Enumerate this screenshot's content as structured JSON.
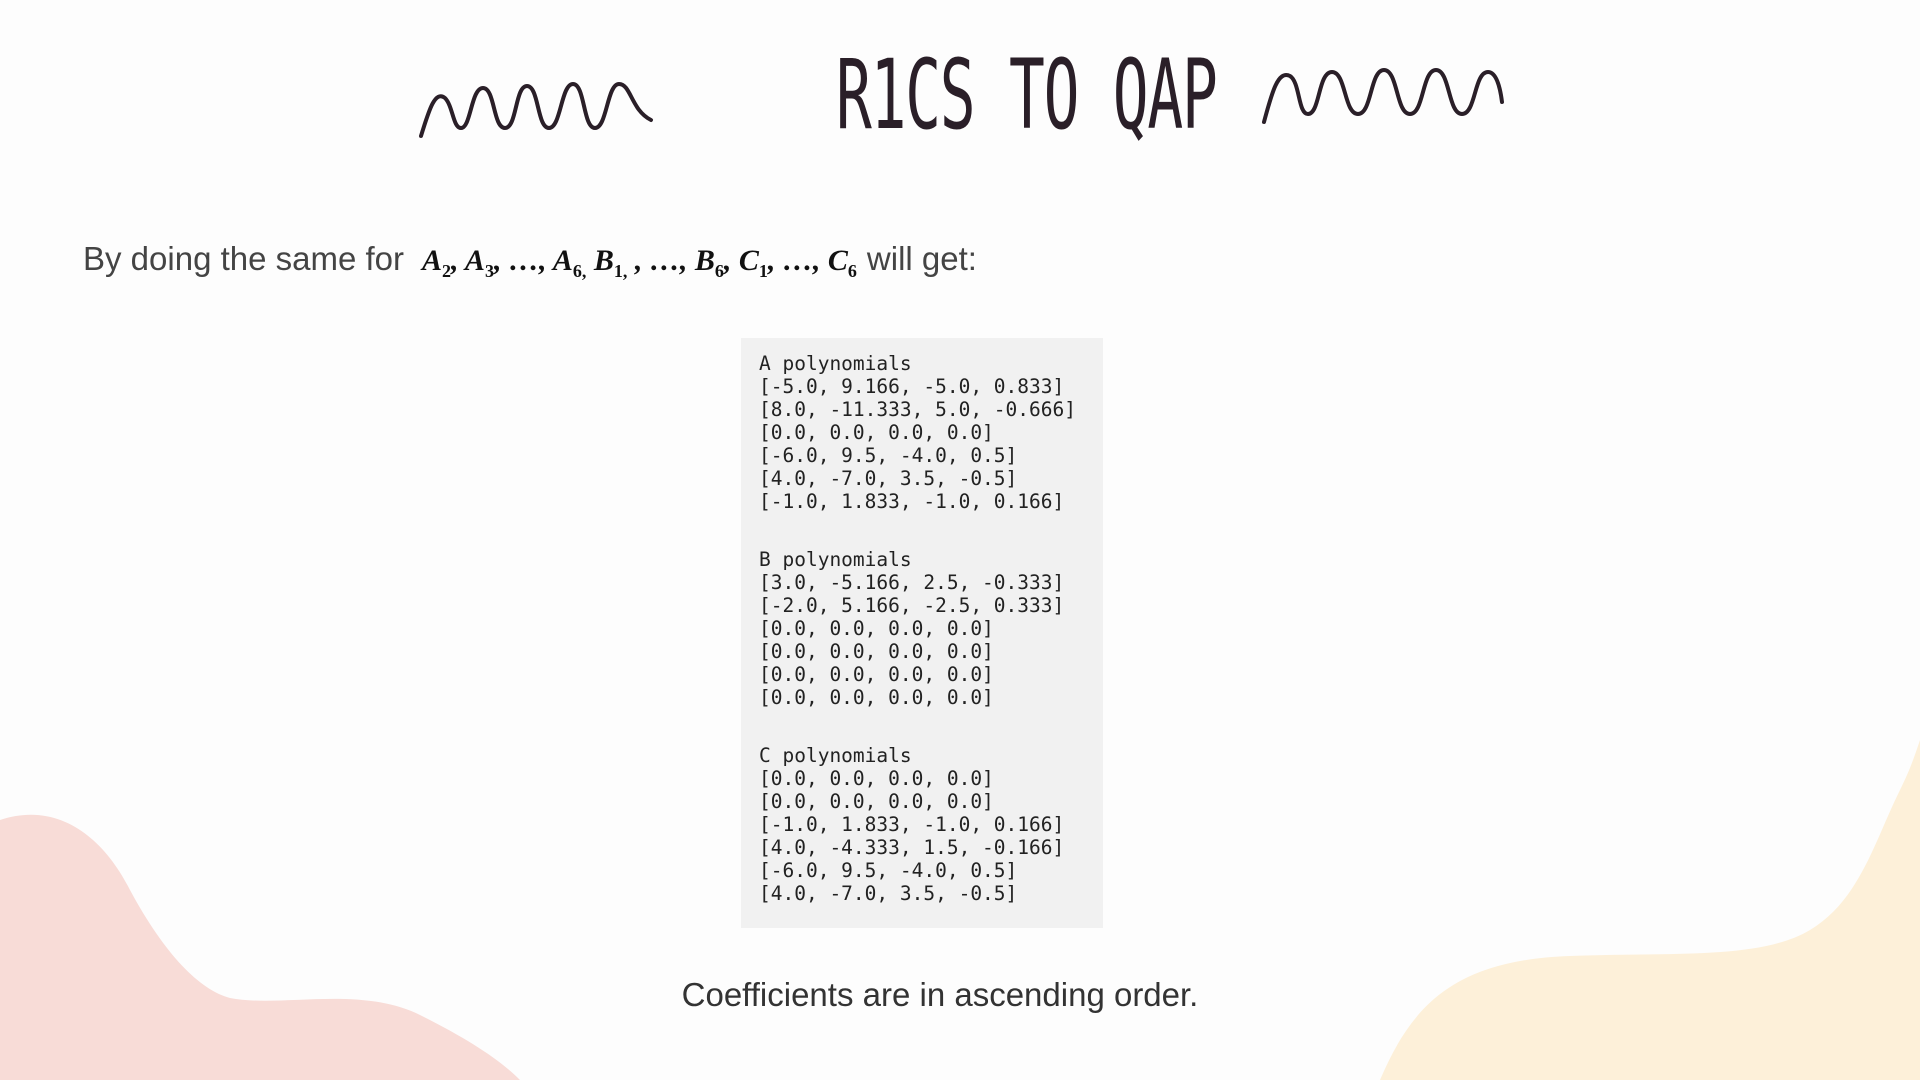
{
  "slide": {
    "title": "R1CS TO QAP",
    "intro_prefix": "By doing the same for",
    "intro_suffix": "will get:",
    "footnote": "Coefficients are in ascending order."
  },
  "polynomials": {
    "A": {
      "header": "A polynomials",
      "rows": [
        "[-5.0, 9.166, -5.0, 0.833]",
        "[8.0, -11.333, 5.0, -0.666]",
        "[0.0, 0.0, 0.0, 0.0]",
        "[-6.0, 9.5, -4.0, 0.5]",
        "[4.0, -7.0, 3.5, -0.5]",
        "[-1.0, 1.833, -1.0, 0.166]"
      ]
    },
    "B": {
      "header": "B polynomials",
      "rows": [
        "[3.0, -5.166, 2.5, -0.333]",
        "[-2.0, 5.166, -2.5, 0.333]",
        "[0.0, 0.0, 0.0, 0.0]",
        "[0.0, 0.0, 0.0, 0.0]",
        "[0.0, 0.0, 0.0, 0.0]",
        "[0.0, 0.0, 0.0, 0.0]"
      ]
    },
    "C": {
      "header": "C polynomials",
      "rows": [
        "[0.0, 0.0, 0.0, 0.0]",
        "[0.0, 0.0, 0.0, 0.0]",
        "[-1.0, 1.833, -1.0, 0.166]",
        "[4.0, -4.333, 1.5, -0.166]",
        "[-6.0, 9.5, -4.0, 0.5]",
        "[4.0, -7.0, 3.5, -0.5]"
      ]
    }
  },
  "colors": {
    "background": "#fdfdfd",
    "blob_left": "#f8dcd7",
    "blob_right": "#fdf0d9",
    "code_background": "#f1f1f1",
    "ink": "#2a1f28"
  },
  "icons": {
    "left_decoration": "squiggle-line",
    "right_decoration": "squiggle-line"
  }
}
